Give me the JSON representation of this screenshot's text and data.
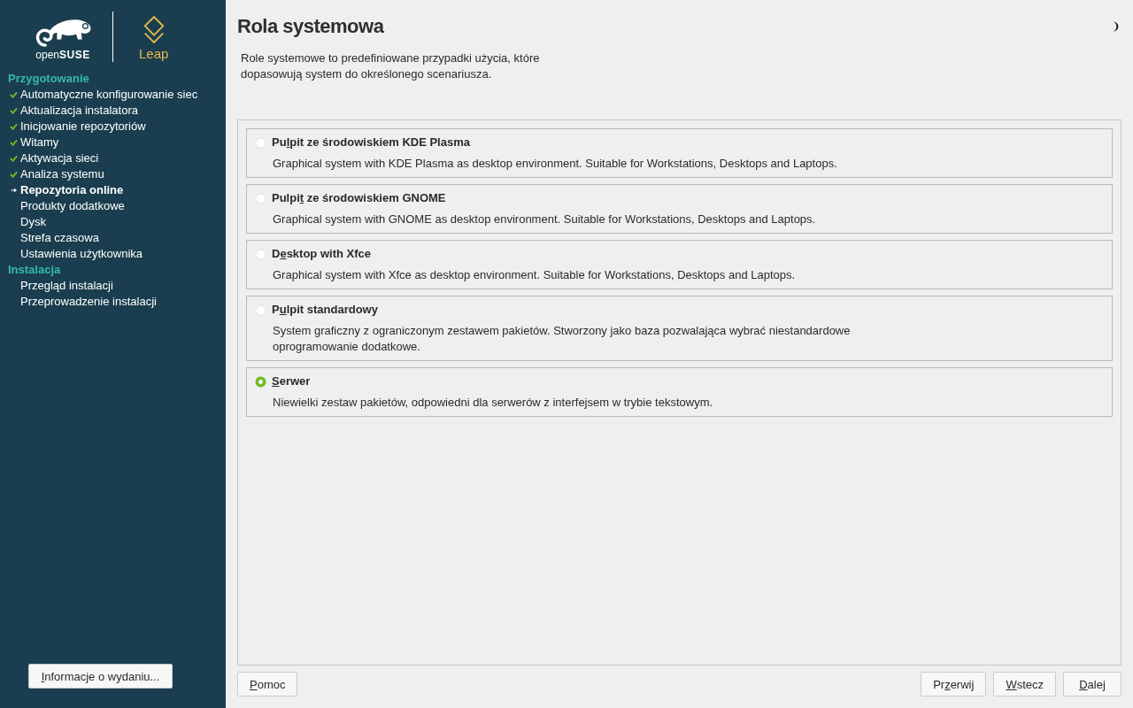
{
  "sidebar": {
    "logo": {
      "brand": "open**SUSE**",
      "product": "Leap"
    },
    "sections": [
      {
        "title": "Przygotowanie",
        "items": [
          {
            "label": "Automatyczne konfigurowanie siec",
            "done": true,
            "current": false
          },
          {
            "label": "Aktualizacja instalatora",
            "done": true,
            "current": false
          },
          {
            "label": "Inicjowanie repozytoriów",
            "done": true,
            "current": false
          },
          {
            "label": "Witamy",
            "done": true,
            "current": false
          },
          {
            "label": "Aktywacja sieci",
            "done": true,
            "current": false
          },
          {
            "label": "Analiza systemu",
            "done": true,
            "current": false
          },
          {
            "label": "Repozytoria online",
            "done": false,
            "current": true
          },
          {
            "label": "Produkty dodatkowe",
            "done": false,
            "current": false
          },
          {
            "label": "Dysk",
            "done": false,
            "current": false
          },
          {
            "label": "Strefa czasowa",
            "done": false,
            "current": false
          },
          {
            "label": "Ustawienia użytkownika",
            "done": false,
            "current": false
          }
        ]
      },
      {
        "title": "Instalacja",
        "items": [
          {
            "label": "Przegląd instalacji",
            "done": false,
            "current": false
          },
          {
            "label": "Przeprowadzenie instalacji",
            "done": false,
            "current": false
          }
        ]
      }
    ],
    "release_notes_button": {
      "mnemonic": "I",
      "post": "nformacje o wydaniu..."
    }
  },
  "header": {
    "title": "Rola systemowa",
    "description": "Role systemowe to predefiniowane przypadki użycia, które\ndopasowują system do określonego scenariusza."
  },
  "roles": [
    {
      "label": {
        "pre": "Pu",
        "mnemonic": "l",
        "post": "pit ze środowiskiem KDE Plasma"
      },
      "description": "Graphical system with KDE Plasma as desktop environment. Suitable for Workstations, Desktops and Laptops.",
      "selected": false
    },
    {
      "label": {
        "pre": "Pulpi",
        "mnemonic": "t",
        "post": " ze środowiskiem GNOME"
      },
      "description": "Graphical system with GNOME as desktop environment. Suitable for Workstations, Desktops and Laptops.",
      "selected": false
    },
    {
      "label": {
        "pre": "D",
        "mnemonic": "e",
        "post": "sktop with Xfce"
      },
      "description": "Graphical system with Xfce as desktop environment. Suitable for Workstations, Desktops and Laptops.",
      "selected": false
    },
    {
      "label": {
        "pre": "P",
        "mnemonic": "u",
        "post": "lpit standardowy"
      },
      "description": "System graficzny z ograniczonym zestawem pakietów. Stworzony jako baza pozwalająca wybrać niestandardowe\noprogramowanie dodatkowe.",
      "selected": false
    },
    {
      "label": {
        "mnemonic": "S",
        "post": "erwer"
      },
      "description": "Niewielki zestaw pakietów, odpowiedni dla serwerów z interfejsem w trybie tekstowym.",
      "selected": true
    }
  ],
  "footer": {
    "help_button": {
      "mnemonic": "P",
      "post": "omoc"
    },
    "nav_buttons": [
      {
        "pre": "Pr",
        "mnemonic": "z",
        "post": "erwij"
      },
      {
        "mnemonic": "W",
        "post": "stecz"
      },
      {
        "mnemonic": "D",
        "post": "alej"
      }
    ]
  }
}
